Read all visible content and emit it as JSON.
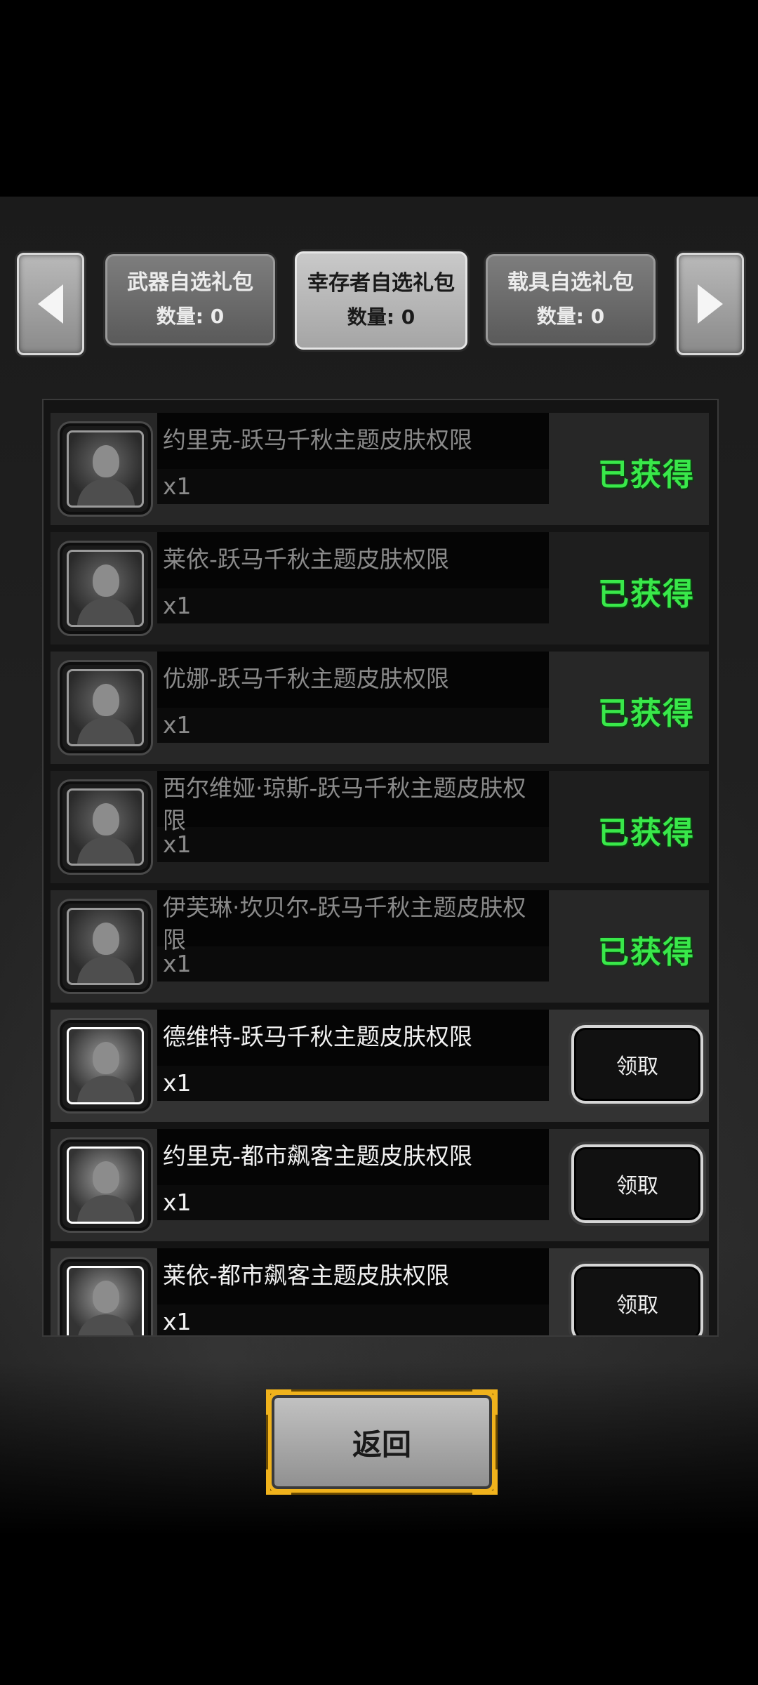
{
  "gift_tabs": [
    {
      "name": "武器自选礼包",
      "count_label": "数量: 0"
    },
    {
      "name": "幸存者自选礼包",
      "count_label": "数量: 0"
    },
    {
      "name": "载具自选礼包",
      "count_label": "数量: 0"
    }
  ],
  "active_tab": "幸存者自选礼包",
  "items": [
    {
      "name": "约里克-跃马千秋主题皮肤权限",
      "qty": "x1",
      "status": "已获得"
    },
    {
      "name": "莱依-跃马千秋主题皮肤权限",
      "qty": "x1",
      "status": "已获得"
    },
    {
      "name": "优娜-跃马千秋主题皮肤权限",
      "qty": "x1",
      "status": "已获得"
    },
    {
      "name": "西尔维娅·琼斯-跃马千秋主题皮肤权限",
      "qty": "x1",
      "status": "已获得"
    },
    {
      "name": "伊芙琳·坎贝尔-跃马千秋主题皮肤权限",
      "qty": "x1",
      "status": "已获得"
    },
    {
      "name": "德维特-跃马千秋主题皮肤权限",
      "qty": "x1",
      "action": "领取"
    },
    {
      "name": "约里克-都市飙客主题皮肤权限",
      "qty": "x1",
      "action": "领取"
    },
    {
      "name": "莱依-都市飙客主题皮肤权限",
      "qty": "x1",
      "action": "领取"
    }
  ],
  "back_button": "返回",
  "colors": {
    "obtained_green": "#39e84a",
    "back_border_gold": "#f0b21c"
  },
  "icons": [
    "arrow-left-icon",
    "arrow-right-icon",
    "character-portrait-icon"
  ]
}
